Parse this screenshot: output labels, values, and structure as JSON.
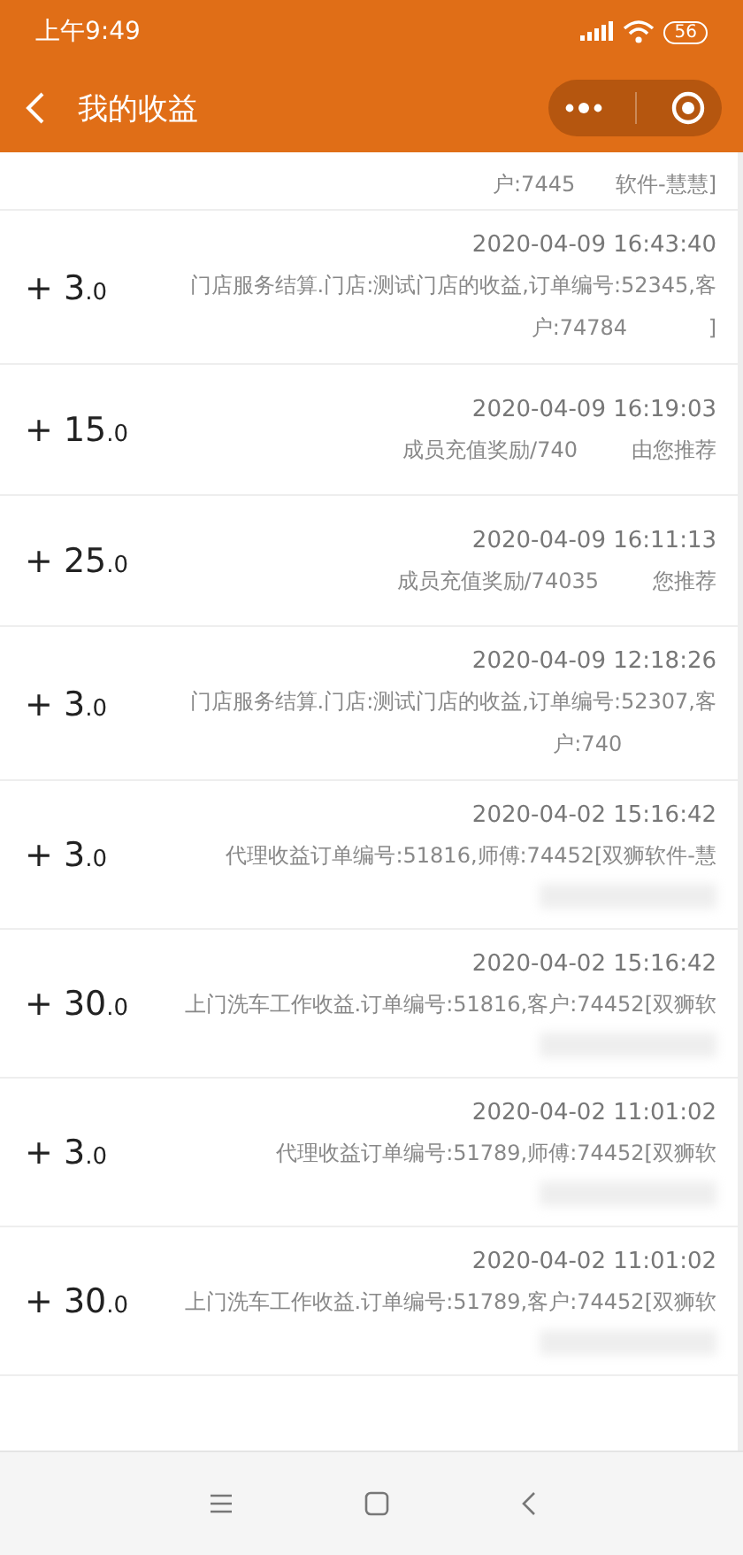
{
  "status_bar": {
    "time": "上午9:49",
    "battery": "56"
  },
  "nav": {
    "title": "我的收益"
  },
  "top_partial": {
    "lines": [
      "户:7445      软件-慧慧]"
    ]
  },
  "records": [
    {
      "amount": "+ 3",
      "fraction": ".0",
      "date": "2020-04-09 16:43:40",
      "lines": [
        "门店服务结算.门店:测试门店的收益,订单编号:52345,客",
        "户:74784            ]"
      ],
      "redacted": false
    },
    {
      "amount": "+ 15",
      "fraction": ".0",
      "date": "2020-04-09 16:19:03",
      "lines": [
        "成员充值奖励/740        由您推荐"
      ],
      "redacted": false
    },
    {
      "amount": "+ 25",
      "fraction": ".0",
      "date": "2020-04-09 16:11:13",
      "lines": [
        "成员充值奖励/74035        您推荐"
      ],
      "redacted": false
    },
    {
      "amount": "+ 3",
      "fraction": ".0",
      "date": "2020-04-09 12:18:26",
      "lines": [
        "门店服务结算.门店:测试门店的收益,订单编号:52307,客",
        "户:740              "
      ],
      "redacted": false
    },
    {
      "amount": "+ 3",
      "fraction": ".0",
      "date": "2020-04-02 15:16:42",
      "lines": [
        "代理收益订单编号:51816,师傅:74452[双狮软件-慧"
      ],
      "redacted": true
    },
    {
      "amount": "+ 30",
      "fraction": ".0",
      "date": "2020-04-02 15:16:42",
      "lines": [
        "上门洗车工作收益.订单编号:51816,客户:74452[双狮软"
      ],
      "redacted": true
    },
    {
      "amount": "+ 3",
      "fraction": ".0",
      "date": "2020-04-02 11:01:02",
      "lines": [
        "代理收益订单编号:51789,师傅:74452[双狮软"
      ],
      "redacted": true
    },
    {
      "amount": "+ 30",
      "fraction": ".0",
      "date": "2020-04-02 11:01:02",
      "lines": [
        "上门洗车工作收益.订单编号:51789,客户:74452[双狮软"
      ],
      "redacted": true
    }
  ]
}
